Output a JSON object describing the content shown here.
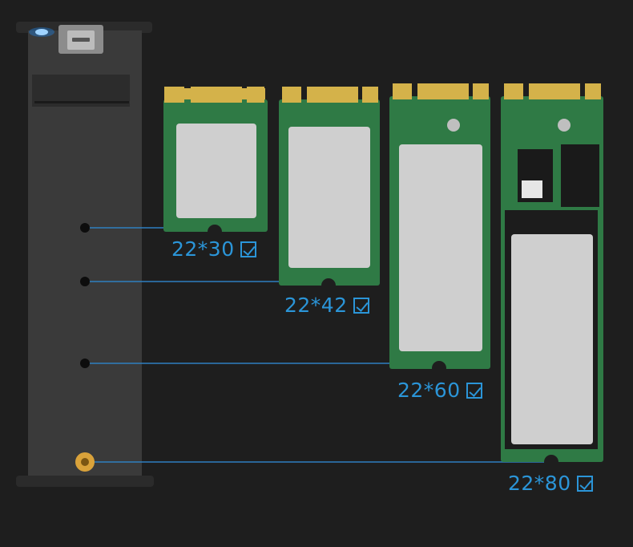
{
  "sizes": [
    {
      "label": "22*30"
    },
    {
      "label": "22*42"
    },
    {
      "label": "22*60"
    },
    {
      "label": "22*80"
    }
  ],
  "colors": {
    "background": "#1e1e1e",
    "enclosure": "#3a3a3a",
    "pcb": "#2f7a45",
    "gold_fingers": "#d4b24a",
    "label_sticker": "#cfcfcf",
    "accent_blue": "#2b95d8",
    "guide_line": "#2e7fc0",
    "led": "#1e90ff",
    "brass_standoff": "#d9a23a"
  }
}
